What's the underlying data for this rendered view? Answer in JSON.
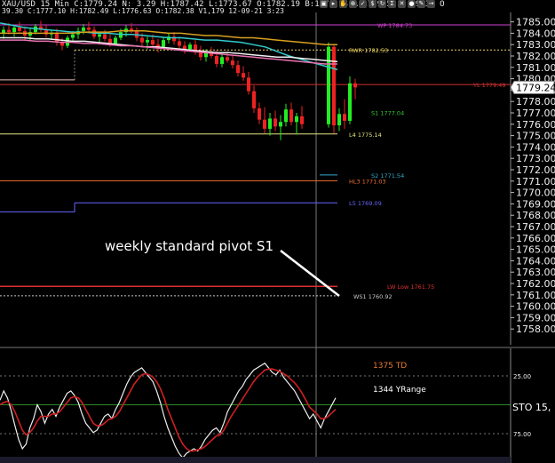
{
  "header": {
    "line1": "XAU/USD 15 Min C:1779.24 N: 3.29 H:1787.42 L:1773.67 O:1782.19 B:1779.24 A:1779.59 V:39.3K O",
    "line2": "39.30 C:1777.10 H:1782.49 L:1776.63 O:1782.38 V1,179 12-09-21 3:23",
    "toolbar_icons": [
      "lock-icon",
      "select-icon",
      "hand-icon",
      "zoom-icon",
      "check-icon",
      "dollar-icon",
      "refresh-icon",
      "sigma-icon",
      "close-icon",
      "record-icon",
      "draw-icon",
      "arrow-icon"
    ]
  },
  "chart_data": [
    {
      "type": "candlestick",
      "title": "",
      "ylim": [
        1758,
        1786
      ],
      "y_ticks": [
        "1785.00",
        "1784.00",
        "1783.00",
        "1782.00",
        "1781.00",
        "1780.00",
        "1779.00",
        "1778.00",
        "1777.00",
        "1776.00",
        "1775.00",
        "1774.00",
        "1773.00",
        "1772.00",
        "1771.00",
        "1770.00",
        "1769.00",
        "1768.00",
        "1767.00",
        "1766.00",
        "1765.00",
        "1764.00",
        "1763.00",
        "1762.00",
        "1761.00",
        "1760.00",
        "1759.00",
        "1758.00"
      ],
      "current_price": "1779.24",
      "levels": [
        {
          "label": "WP 1784.73",
          "value": 1784.73,
          "color": "#d040d0"
        },
        {
          "label": "RWR 1782.53",
          "value": 1782.53,
          "color": "#e8d060"
        },
        {
          "label": "YL 1779.49",
          "value": 1779.49,
          "color": "#d03030"
        },
        {
          "label": "S1 1777.04",
          "value": 1777.04,
          "color": "#33cc33"
        },
        {
          "label": "L4 1775.14",
          "value": 1775.14,
          "color": "#e8e880"
        },
        {
          "label": "S2 1771.54",
          "value": 1771.54,
          "color": "#33aacc"
        },
        {
          "label": "HL3 1771.03",
          "value": 1771.03,
          "color": "#f07030"
        },
        {
          "label": "L5 1769.09",
          "value": 1769.09,
          "color": "#6666ff"
        },
        {
          "label": "LW Low 1761.75",
          "value": 1761.75,
          "color": "#e03030"
        },
        {
          "label": "WS1 1760.92",
          "value": 1760.92,
          "color": "#c8c8c8"
        }
      ],
      "annotation": "weekly standard pivot S1",
      "candles": [
        [
          1784.0,
          1784.6,
          1783.5,
          1784.3
        ],
        [
          1784.3,
          1784.9,
          1783.9,
          1784.1
        ],
        [
          1784.1,
          1784.7,
          1783.7,
          1784.5
        ],
        [
          1784.5,
          1785.0,
          1784.0,
          1784.2
        ],
        [
          1784.2,
          1784.6,
          1783.4,
          1783.8
        ],
        [
          1783.8,
          1784.4,
          1783.3,
          1784.1
        ],
        [
          1784.1,
          1784.8,
          1783.9,
          1784.6
        ],
        [
          1784.6,
          1785.1,
          1784.1,
          1784.3
        ],
        [
          1784.3,
          1784.7,
          1783.6,
          1783.9
        ],
        [
          1783.9,
          1784.3,
          1783.4,
          1784.0
        ],
        [
          1784.0,
          1784.4,
          1782.9,
          1783.2
        ],
        [
          1783.2,
          1783.6,
          1782.5,
          1782.9
        ],
        [
          1782.9,
          1783.8,
          1782.7,
          1783.6
        ],
        [
          1783.6,
          1784.2,
          1783.2,
          1783.9
        ],
        [
          1783.9,
          1784.5,
          1783.5,
          1784.2
        ],
        [
          1784.2,
          1784.8,
          1783.9,
          1784.5
        ],
        [
          1784.5,
          1785.0,
          1784.0,
          1784.3
        ],
        [
          1784.3,
          1784.6,
          1783.5,
          1783.7
        ],
        [
          1783.7,
          1784.1,
          1783.2,
          1783.9
        ],
        [
          1783.9,
          1784.3,
          1783.3,
          1783.5
        ],
        [
          1783.5,
          1783.9,
          1782.8,
          1783.1
        ],
        [
          1783.1,
          1783.8,
          1782.9,
          1783.6
        ],
        [
          1783.6,
          1784.4,
          1783.4,
          1784.1
        ],
        [
          1784.1,
          1784.7,
          1783.7,
          1784.4
        ],
        [
          1784.4,
          1784.9,
          1784.0,
          1784.2
        ],
        [
          1784.2,
          1784.5,
          1783.3,
          1783.6
        ],
        [
          1783.6,
          1784.0,
          1782.9,
          1783.2
        ],
        [
          1783.2,
          1783.7,
          1782.6,
          1783.4
        ],
        [
          1783.4,
          1783.9,
          1782.8,
          1783.0
        ],
        [
          1783.0,
          1783.5,
          1782.3,
          1782.8
        ],
        [
          1782.8,
          1783.6,
          1782.6,
          1783.4
        ],
        [
          1783.4,
          1784.0,
          1783.1,
          1783.7
        ],
        [
          1783.7,
          1784.1,
          1783.0,
          1783.3
        ],
        [
          1783.3,
          1783.7,
          1782.5,
          1782.9
        ],
        [
          1782.9,
          1783.3,
          1782.2,
          1782.6
        ],
        [
          1782.6,
          1783.2,
          1782.4,
          1783.0
        ],
        [
          1783.0,
          1783.4,
          1782.1,
          1782.4
        ],
        [
          1782.4,
          1782.9,
          1781.6,
          1781.9
        ],
        [
          1781.9,
          1782.6,
          1781.5,
          1782.3
        ],
        [
          1782.3,
          1782.8,
          1781.8,
          1782.0
        ],
        [
          1782.0,
          1782.5,
          1781.0,
          1781.3
        ],
        [
          1781.3,
          1782.2,
          1781.0,
          1781.9
        ],
        [
          1781.9,
          1782.4,
          1781.4,
          1781.6
        ],
        [
          1781.6,
          1782.0,
          1780.9,
          1781.2
        ],
        [
          1781.2,
          1781.6,
          1780.2,
          1780.5
        ],
        [
          1780.5,
          1781.1,
          1779.8,
          1780.1
        ],
        [
          1780.1,
          1780.6,
          1778.6,
          1778.9
        ],
        [
          1778.9,
          1779.4,
          1777.0,
          1777.4
        ],
        [
          1777.4,
          1777.9,
          1776.0,
          1776.4
        ],
        [
          1776.4,
          1777.5,
          1775.2,
          1775.6
        ],
        [
          1775.6,
          1777.0,
          1775.0,
          1776.5
        ],
        [
          1776.5,
          1777.2,
          1775.4,
          1775.8
        ],
        [
          1775.8,
          1776.8,
          1774.6,
          1776.2
        ],
        [
          1776.2,
          1777.8,
          1775.8,
          1777.3
        ],
        [
          1777.3,
          1777.9,
          1775.9,
          1776.2
        ],
        [
          1776.2,
          1777.0,
          1775.1,
          1776.7
        ],
        [
          1776.7,
          1777.6,
          1775.6,
          1776.0
        ],
        [
          1776.0,
          1783.2,
          1775.7,
          1782.8
        ],
        [
          1782.8,
          1783.0,
          1775.2,
          1775.9
        ],
        [
          1775.9,
          1777.4,
          1775.4,
          1776.9
        ],
        [
          1776.9,
          1778.2,
          1775.6,
          1776.3
        ],
        [
          1776.3,
          1780.2,
          1776.0,
          1779.6
        ],
        [
          1779.6,
          1780.0,
          1778.2,
          1779.24
        ]
      ],
      "moving_averages": [
        {
          "color": "#33cccc",
          "values": [
            1784.9,
            1784.7,
            1784.5,
            1784.4,
            1784.3,
            1784.2,
            1784.1,
            1784.1,
            1784.0,
            1784.0,
            1783.9,
            1783.9,
            1783.8,
            1783.7,
            1783.6,
            1783.6,
            1783.5,
            1783.4,
            1783.4,
            1783.3,
            1783.2,
            1783.0,
            1782.8,
            1782.4,
            1782.0,
            1781.7,
            1781.4,
            1781.1,
            1780.8
          ]
        },
        {
          "color": "#d8a020",
          "values": [
            1784.0,
            1784.0,
            1784.0,
            1784.0,
            1784.0,
            1784.0,
            1784.0,
            1784.1,
            1784.1,
            1784.1,
            1784.2,
            1784.2,
            1784.2,
            1784.1,
            1784.0,
            1784.0,
            1783.9,
            1783.8,
            1783.8,
            1783.7,
            1783.6,
            1783.6,
            1783.5,
            1783.4,
            1783.3,
            1783.2,
            1783.1,
            1783.0,
            1783.0
          ]
        },
        {
          "color": "#f0f0f0",
          "values": [
            1783.6,
            1783.6,
            1783.6,
            1783.5,
            1783.5,
            1783.4,
            1783.3,
            1783.3,
            1783.2,
            1783.1,
            1783.0,
            1782.9,
            1782.8,
            1782.8,
            1782.7,
            1782.6,
            1782.5,
            1782.4,
            1782.3,
            1782.3,
            1782.2,
            1782.1,
            1782.0,
            1781.9,
            1781.9,
            1781.8,
            1781.7,
            1781.6,
            1781.5
          ]
        },
        {
          "color": "#e870b0",
          "values": [
            1783.4,
            1783.4,
            1783.4,
            1783.3,
            1783.3,
            1783.2,
            1783.2,
            1783.1,
            1783.1,
            1783.0,
            1782.9,
            1782.9,
            1782.8,
            1782.7,
            1782.6,
            1782.5,
            1782.4,
            1782.3,
            1782.2,
            1782.1,
            1782.0,
            1781.9,
            1781.8,
            1781.7,
            1781.6,
            1781.5,
            1781.4,
            1781.3,
            1781.3
          ]
        }
      ]
    },
    {
      "type": "line",
      "title": "STO 15,",
      "labels": [
        "1375 TD",
        "1344 YRange"
      ],
      "y_ticks": [
        "25.00",
        "75.00"
      ],
      "ylim": [
        100,
        0
      ],
      "series": [
        {
          "color": "#f0f0f0",
          "values": [
            46,
            38,
            44,
            55,
            68,
            80,
            88,
            84,
            70,
            62,
            50,
            56,
            66,
            58,
            54,
            60,
            52,
            46,
            40,
            38,
            42,
            48,
            58,
            66,
            70,
            74,
            72,
            66,
            60,
            58,
            62,
            54,
            48,
            40,
            32,
            26,
            22,
            20,
            18,
            22,
            26,
            30,
            38,
            48,
            60,
            70,
            78,
            86,
            92,
            96,
            92,
            90,
            88,
            90,
            86,
            80,
            76,
            72,
            70,
            74,
            66,
            56,
            50,
            44,
            38,
            34,
            28,
            24,
            20,
            18,
            16,
            14,
            18,
            22,
            24,
            20,
            26,
            30,
            34,
            38,
            44,
            50,
            56,
            62,
            58,
            64,
            70,
            62,
            56,
            50,
            44
          ]
        },
        {
          "color": "#d02020",
          "values": [
            50,
            48,
            47,
            50,
            56,
            64,
            72,
            76,
            74,
            70,
            64,
            60,
            60,
            60,
            58,
            58,
            56,
            52,
            48,
            44,
            43,
            44,
            48,
            54,
            60,
            66,
            68,
            68,
            66,
            63,
            62,
            60,
            56,
            50,
            44,
            38,
            32,
            28,
            24,
            23,
            24,
            26,
            30,
            36,
            44,
            54,
            62,
            70,
            78,
            84,
            88,
            90,
            90,
            89,
            88,
            86,
            83,
            80,
            77,
            76,
            72,
            66,
            60,
            55,
            50,
            45,
            40,
            35,
            30,
            26,
            23,
            20,
            19,
            19,
            20,
            21,
            23,
            25,
            28,
            31,
            35,
            40,
            46,
            52,
            55,
            58,
            62,
            62,
            60,
            57,
            54
          ]
        }
      ]
    }
  ]
}
